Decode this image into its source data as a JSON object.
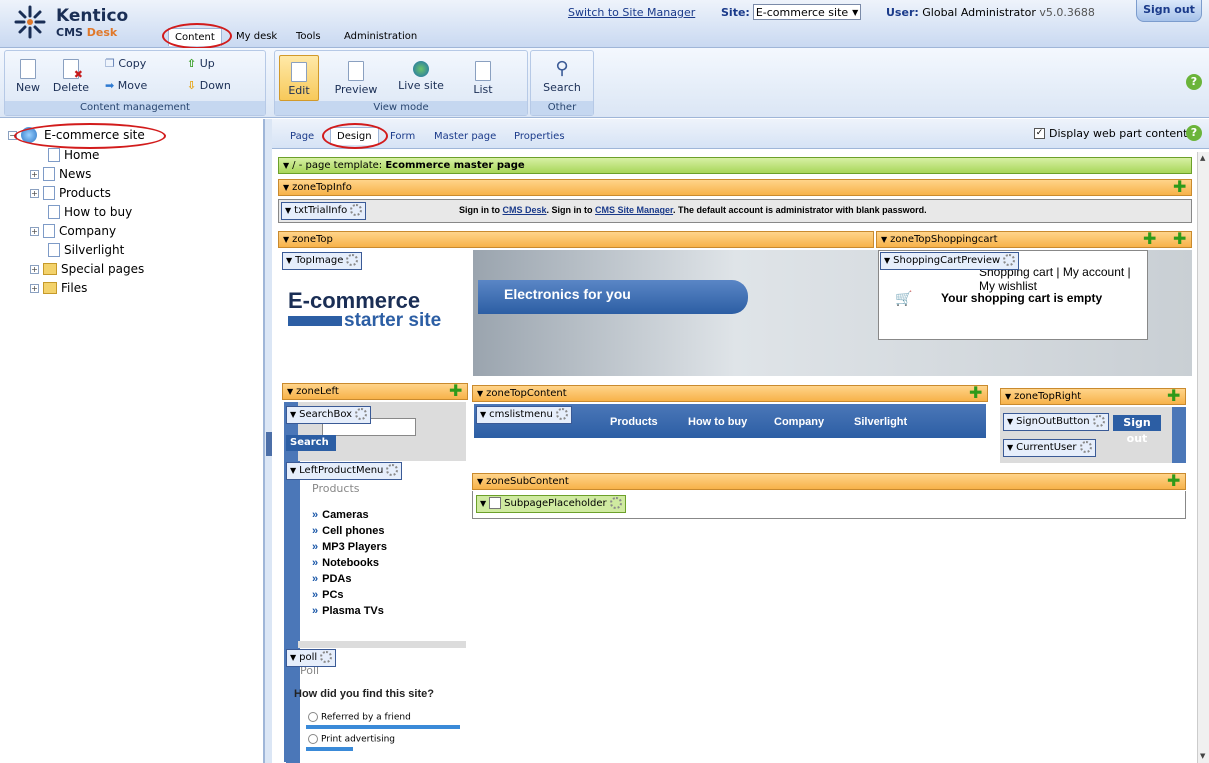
{
  "header": {
    "logo_name": "Kentico",
    "logo_sub_cms": "CMS",
    "logo_sub_desk": "Desk",
    "switch_link": "Switch to Site Manager",
    "site_label": "Site:",
    "site_value": "E-commerce site",
    "user_label": "User:",
    "user_value": "Global Administrator",
    "version": "v5.0.3688",
    "signout": "Sign out",
    "nav": [
      "Content",
      "My desk",
      "Tools",
      "Administration"
    ]
  },
  "toolbar": {
    "content_management": {
      "label": "Content management",
      "new": "New",
      "delete": "Delete",
      "copy": "Copy",
      "move": "Move",
      "up": "Up",
      "down": "Down"
    },
    "view_mode": {
      "label": "View mode",
      "edit": "Edit",
      "preview": "Preview",
      "live_site": "Live site",
      "list": "List"
    },
    "other": {
      "label": "Other",
      "search": "Search"
    }
  },
  "tree": {
    "root": "E-commerce site",
    "items": [
      "Home",
      "News",
      "Products",
      "How to buy",
      "Company",
      "Silverlight",
      "Special pages",
      "Files"
    ]
  },
  "tabs": [
    "Page",
    "Design",
    "Form",
    "Master page",
    "Properties"
  ],
  "display_webpart_label": "Display web part content",
  "design": {
    "template_prefix": "/ - page template:",
    "template_name": "Ecommerce master page",
    "zones": {
      "zoneTopInfo": "zoneTopInfo",
      "zoneTop": "zoneTop",
      "zoneTopShoppingcart": "zoneTopShoppingcart",
      "zoneLeft": "zoneLeft",
      "zoneTopContent": "zoneTopContent",
      "zoneTopRight": "zoneTopRight",
      "zoneSubContent": "zoneSubContent"
    },
    "webparts": {
      "txtTrialInfo": "txtTrialInfo",
      "TopImage": "TopImage",
      "ShoppingCartPreview": "ShoppingCartPreview",
      "SearchBox": "SearchBox",
      "cmslistmenu": "cmslistmenu",
      "SignOutButton": "SignOutButton",
      "CurrentUser": "CurrentUser",
      "LeftProductMenu": "LeftProductMenu",
      "SubpagePlaceholder": "SubpagePlaceholder",
      "poll": "poll"
    },
    "trial_info": {
      "t1": "Sign in to ",
      "l1": "CMS Desk",
      "t2": ". Sign in to ",
      "l2": "CMS Site Manager",
      "t3": ". The default account is administrator with blank password."
    },
    "banner": {
      "title1": "E-commerce",
      "title2": "starter site",
      "slogan": "Electronics for you"
    },
    "cart": {
      "links": "Shopping cart | My account | My wishlist",
      "empty": "Your shopping cart is empty"
    },
    "search_btn": "Search",
    "top_menu": [
      "Products",
      "How to buy",
      "Company",
      "Silverlight"
    ],
    "signout_btn": "Sign out",
    "products_heading": "Products",
    "categories": [
      "Cameras",
      "Cell phones",
      "MP3 Players",
      "Notebooks",
      "PDAs",
      "PCs",
      "Plasma TVs"
    ],
    "poll": {
      "heading": "Poll",
      "question": "How did you find this site?",
      "answers": [
        "Referred by a friend",
        "Print advertising"
      ],
      "answer_fill": [
        0.99,
        0.3
      ]
    }
  },
  "colors": {
    "zone": "#f7b24a",
    "template": "#a8d65a",
    "circle": "#d21b1b",
    "blue": "#4b77b8"
  }
}
